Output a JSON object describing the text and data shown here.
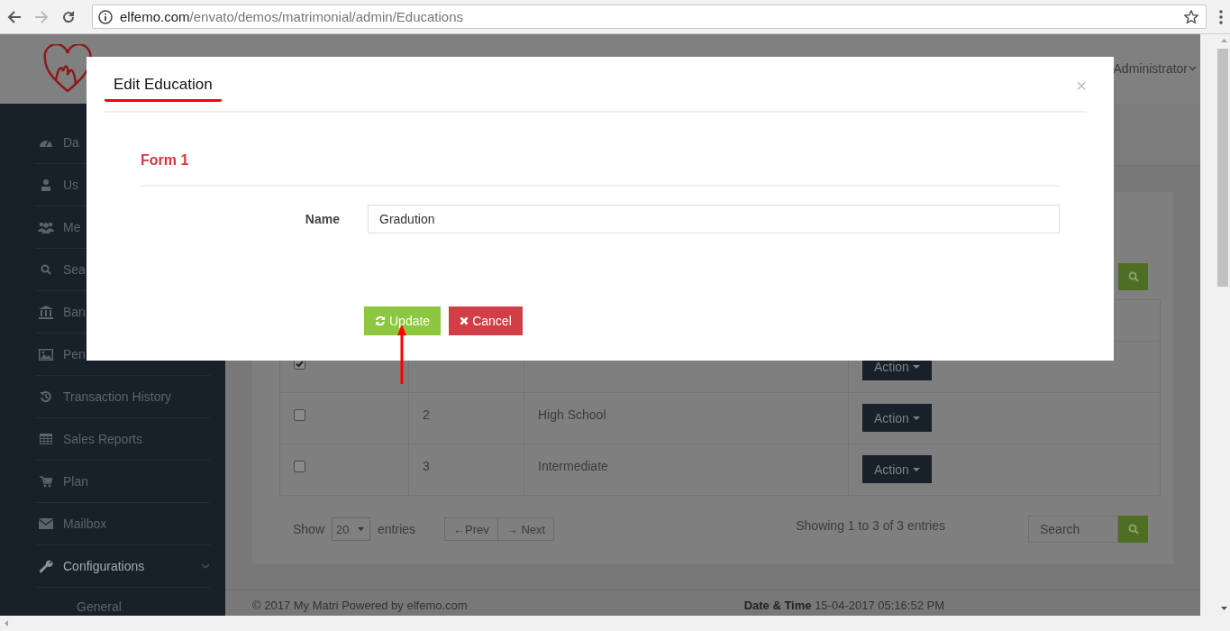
{
  "browser": {
    "url_host": "elfemo.com",
    "url_path": "/envato/demos/matrimonial/admin/Educations"
  },
  "header": {
    "user": "Administrator"
  },
  "sidebar": {
    "items": [
      {
        "label": "Da",
        "selected": false
      },
      {
        "label": "Us",
        "selected": false
      },
      {
        "label": "Me",
        "selected": false
      },
      {
        "label": "Sea",
        "selected": false
      },
      {
        "label": "Ban",
        "selected": false
      },
      {
        "label": "Pen",
        "selected": false
      },
      {
        "label": "Transaction History",
        "selected": false
      },
      {
        "label": "Sales Reports",
        "selected": false
      },
      {
        "label": "Plan",
        "selected": false
      },
      {
        "label": "Mailbox",
        "selected": false
      },
      {
        "label": "Configurations",
        "selected": true,
        "expanded": true,
        "children": [
          {
            "label": "General"
          }
        ]
      }
    ]
  },
  "table": {
    "rows": [
      {
        "checked": true,
        "action": "Action"
      },
      {
        "checked": false,
        "number": "2",
        "name": "High School",
        "action": "Action"
      },
      {
        "checked": false,
        "number": "3",
        "name": "Intermediate",
        "action": "Action"
      }
    ]
  },
  "table_footer": {
    "show": "Show",
    "page_size": "20",
    "entries": "entries",
    "prev": "←Prev",
    "next": "→ Next",
    "info": "Showing 1 to 3 of 3 entries",
    "search_placeholder": "Search"
  },
  "footer": {
    "copyright": "© 2017 My Matri Powered by elfemo.com",
    "datetime_label": "Date & Time",
    "datetime": "15-04-2017 05:16:52 PM"
  },
  "modal": {
    "title": "Edit Education",
    "close": "×",
    "section": "Form 1",
    "field_label": "Name",
    "field_value": "Gradution",
    "buttons": [
      {
        "kind": "update",
        "label": "Update"
      },
      {
        "kind": "cancel",
        "label": "Cancel"
      }
    ]
  }
}
